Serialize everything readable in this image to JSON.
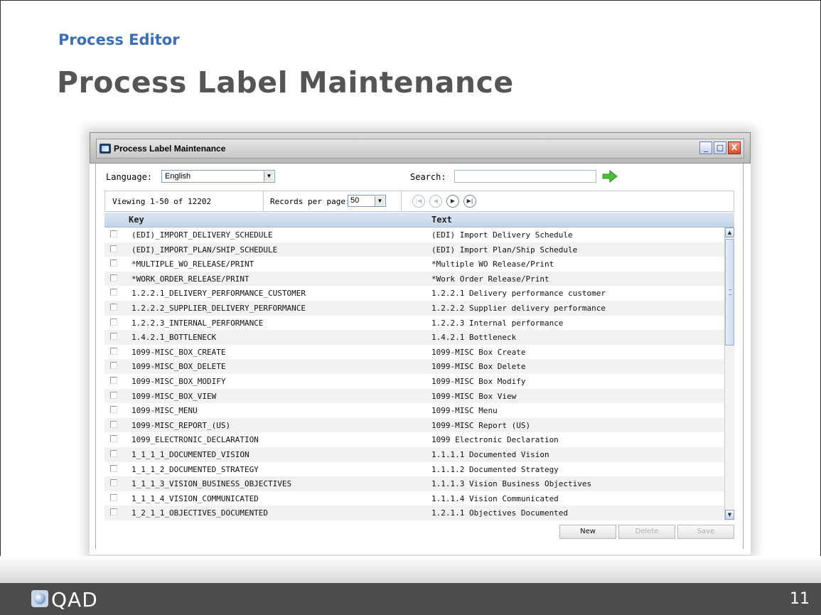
{
  "slide": {
    "subtitle": "Process Editor",
    "title": "Process Label Maintenance",
    "logo_text": "QAD",
    "page_number": "11"
  },
  "window": {
    "title": "Process Label Maintenance",
    "minimize_glyph": "_",
    "maximize_glyph": "□",
    "close_glyph": "X"
  },
  "filters": {
    "language_label": "Language:",
    "language_value": "English",
    "search_label": "Search:",
    "search_value": ""
  },
  "pager": {
    "viewing": "Viewing 1-50 of 12202",
    "records_per_page_label": "Records per page:",
    "records_per_page_value": "50"
  },
  "table": {
    "columns": [
      "Key",
      "Text"
    ],
    "rows": [
      {
        "key": "(EDI)_IMPORT_DELIVERY_SCHEDULE",
        "text": "(EDI) Import Delivery Schedule"
      },
      {
        "key": "(EDI)_IMPORT_PLAN/SHIP_SCHEDULE",
        "text": "(EDI) Import Plan/Ship Schedule"
      },
      {
        "key": "*MULTIPLE_WO_RELEASE/PRINT",
        "text": "*Multiple WO Release/Print"
      },
      {
        "key": "*WORK_ORDER_RELEASE/PRINT",
        "text": "*Work Order Release/Print"
      },
      {
        "key": "1.2.2.1_DELIVERY_PERFORMANCE_CUSTOMER",
        "text": "1.2.2.1 Delivery performance customer"
      },
      {
        "key": "1.2.2.2_SUPPLIER_DELIVERY_PERFORMANCE",
        "text": "1.2.2.2 Supplier delivery performance"
      },
      {
        "key": "1.2.2.3_INTERNAL_PERFORMANCE",
        "text": "1.2.2.3 Internal performance"
      },
      {
        "key": "1.4.2.1_BOTTLENECK",
        "text": "1.4.2.1 Bottleneck"
      },
      {
        "key": "1099-MISC_BOX_CREATE",
        "text": "1099-MISC Box Create"
      },
      {
        "key": "1099-MISC_BOX_DELETE",
        "text": "1099-MISC Box Delete"
      },
      {
        "key": "1099-MISC_BOX_MODIFY",
        "text": "1099-MISC Box Modify"
      },
      {
        "key": "1099-MISC_BOX_VIEW",
        "text": "1099-MISC Box View"
      },
      {
        "key": "1099-MISC_MENU",
        "text": "1099-MISC Menu"
      },
      {
        "key": "1099-MISC_REPORT_(US)",
        "text": "1099-MISC Report (US)"
      },
      {
        "key": "1099_ELECTRONIC_DECLARATION",
        "text": "1099 Electronic Declaration"
      },
      {
        "key": "1_1_1_1_DOCUMENTED_VISION",
        "text": "1.1.1.1 Documented Vision"
      },
      {
        "key": "1_1_1_2_DOCUMENTED_STRATEGY",
        "text": "1.1.1.2 Documented Strategy"
      },
      {
        "key": "1_1_1_3_VISION_BUSINESS_OBJECTIVES",
        "text": "1.1.1.3 Vision Business Objectives"
      },
      {
        "key": "1_1_1_4_VISION_COMMUNICATED",
        "text": "1.1.1.4 Vision Communicated"
      },
      {
        "key": "1_2_1_1_OBJECTIVES_DOCUMENTED",
        "text": "1.2.1.1 Objectives Documented"
      }
    ]
  },
  "buttons": {
    "new": "New",
    "delete": "Delete",
    "save": "Save"
  },
  "icons": {
    "app": "app-icon",
    "go": "arrow-right-icon",
    "first": "first-page-icon",
    "prev": "prev-page-icon",
    "next": "next-page-icon",
    "last": "last-page-icon"
  },
  "colors": {
    "accent": "#3b6fb6",
    "title": "#555555",
    "header_bg": "#c4d5e8",
    "footer_bg": "#4c4c4c",
    "go_arrow": "#4fbf3a",
    "close_button": "#d84a2d"
  }
}
